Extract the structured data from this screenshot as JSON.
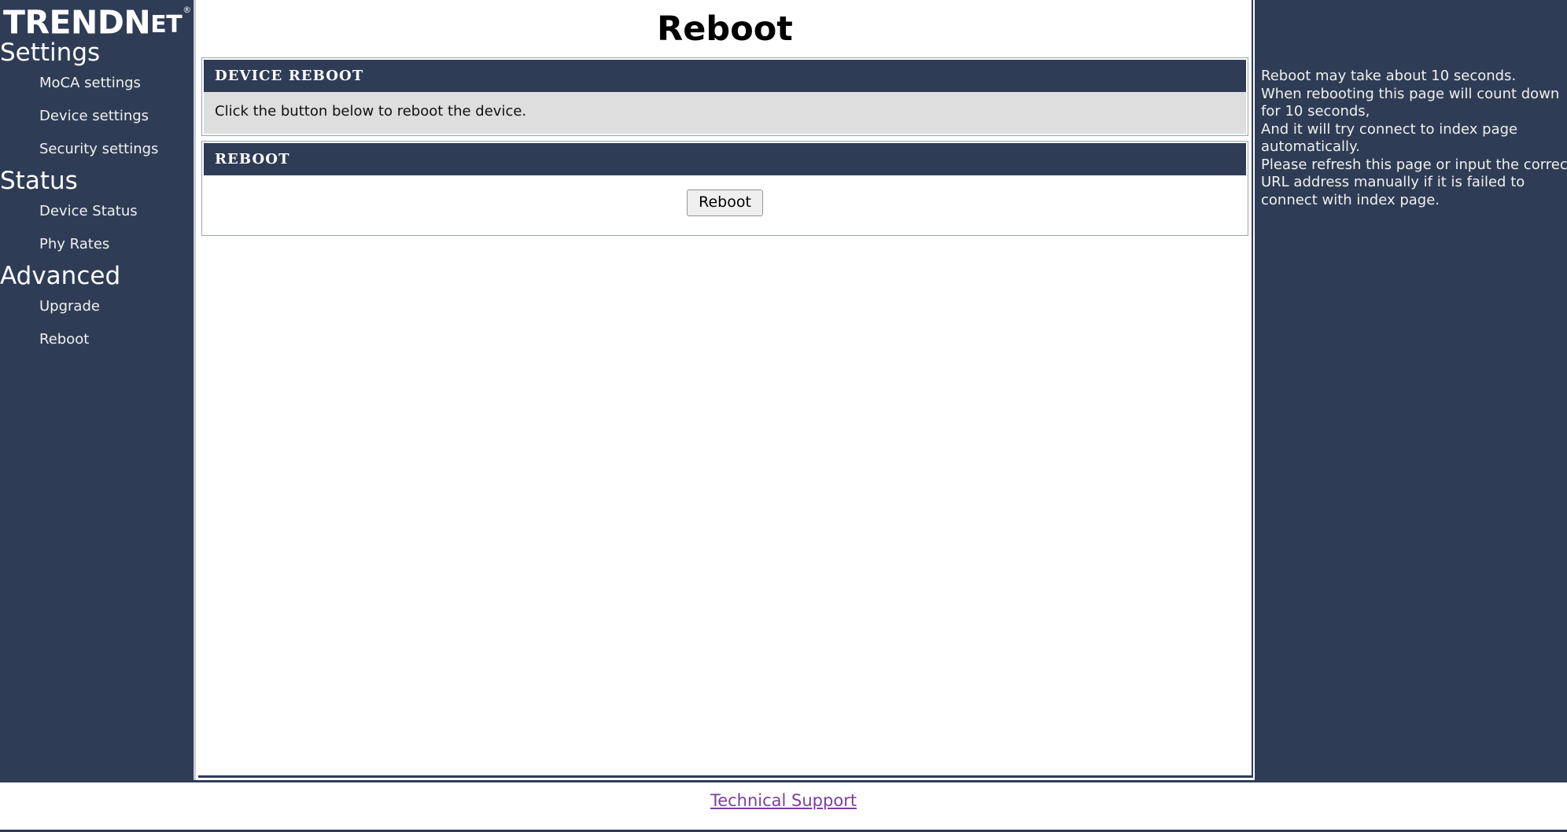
{
  "brand": {
    "logo_main": "TRENDN",
    "logo_secondary": "ET",
    "logo_full": "TRENDnet",
    "registered_mark": "®"
  },
  "sidebar": {
    "groups": [
      {
        "label": "Settings",
        "items": [
          {
            "label": "MoCA settings"
          },
          {
            "label": "Device settings"
          },
          {
            "label": "Security settings"
          }
        ]
      },
      {
        "label": "Status",
        "items": [
          {
            "label": "Device Status"
          },
          {
            "label": "Phy Rates"
          }
        ]
      },
      {
        "label": "Advanced",
        "items": [
          {
            "label": "Upgrade"
          },
          {
            "label": "Reboot"
          }
        ]
      }
    ]
  },
  "main": {
    "page_title": "Reboot",
    "panels": [
      {
        "header": "DEVICE REBOOT",
        "body_text": "Click the button below to reboot the device."
      },
      {
        "header": "REBOOT",
        "button_label": "Reboot"
      }
    ]
  },
  "help": {
    "lines": [
      "Reboot may take about 10 seconds.",
      "When rebooting this page will count down",
      "for 10 seconds,",
      "And it will try connect to index page",
      "automatically.",
      "Please refresh this page or input the correct",
      "URL address manually if it is failed to",
      "connect with index page."
    ]
  },
  "footer": {
    "link_label": "Technical Support"
  },
  "colors": {
    "navy": "#2f3c56",
    "panel_gray": "#dededf",
    "link_purple": "#7b3fa0",
    "button_face": "#efefef"
  }
}
